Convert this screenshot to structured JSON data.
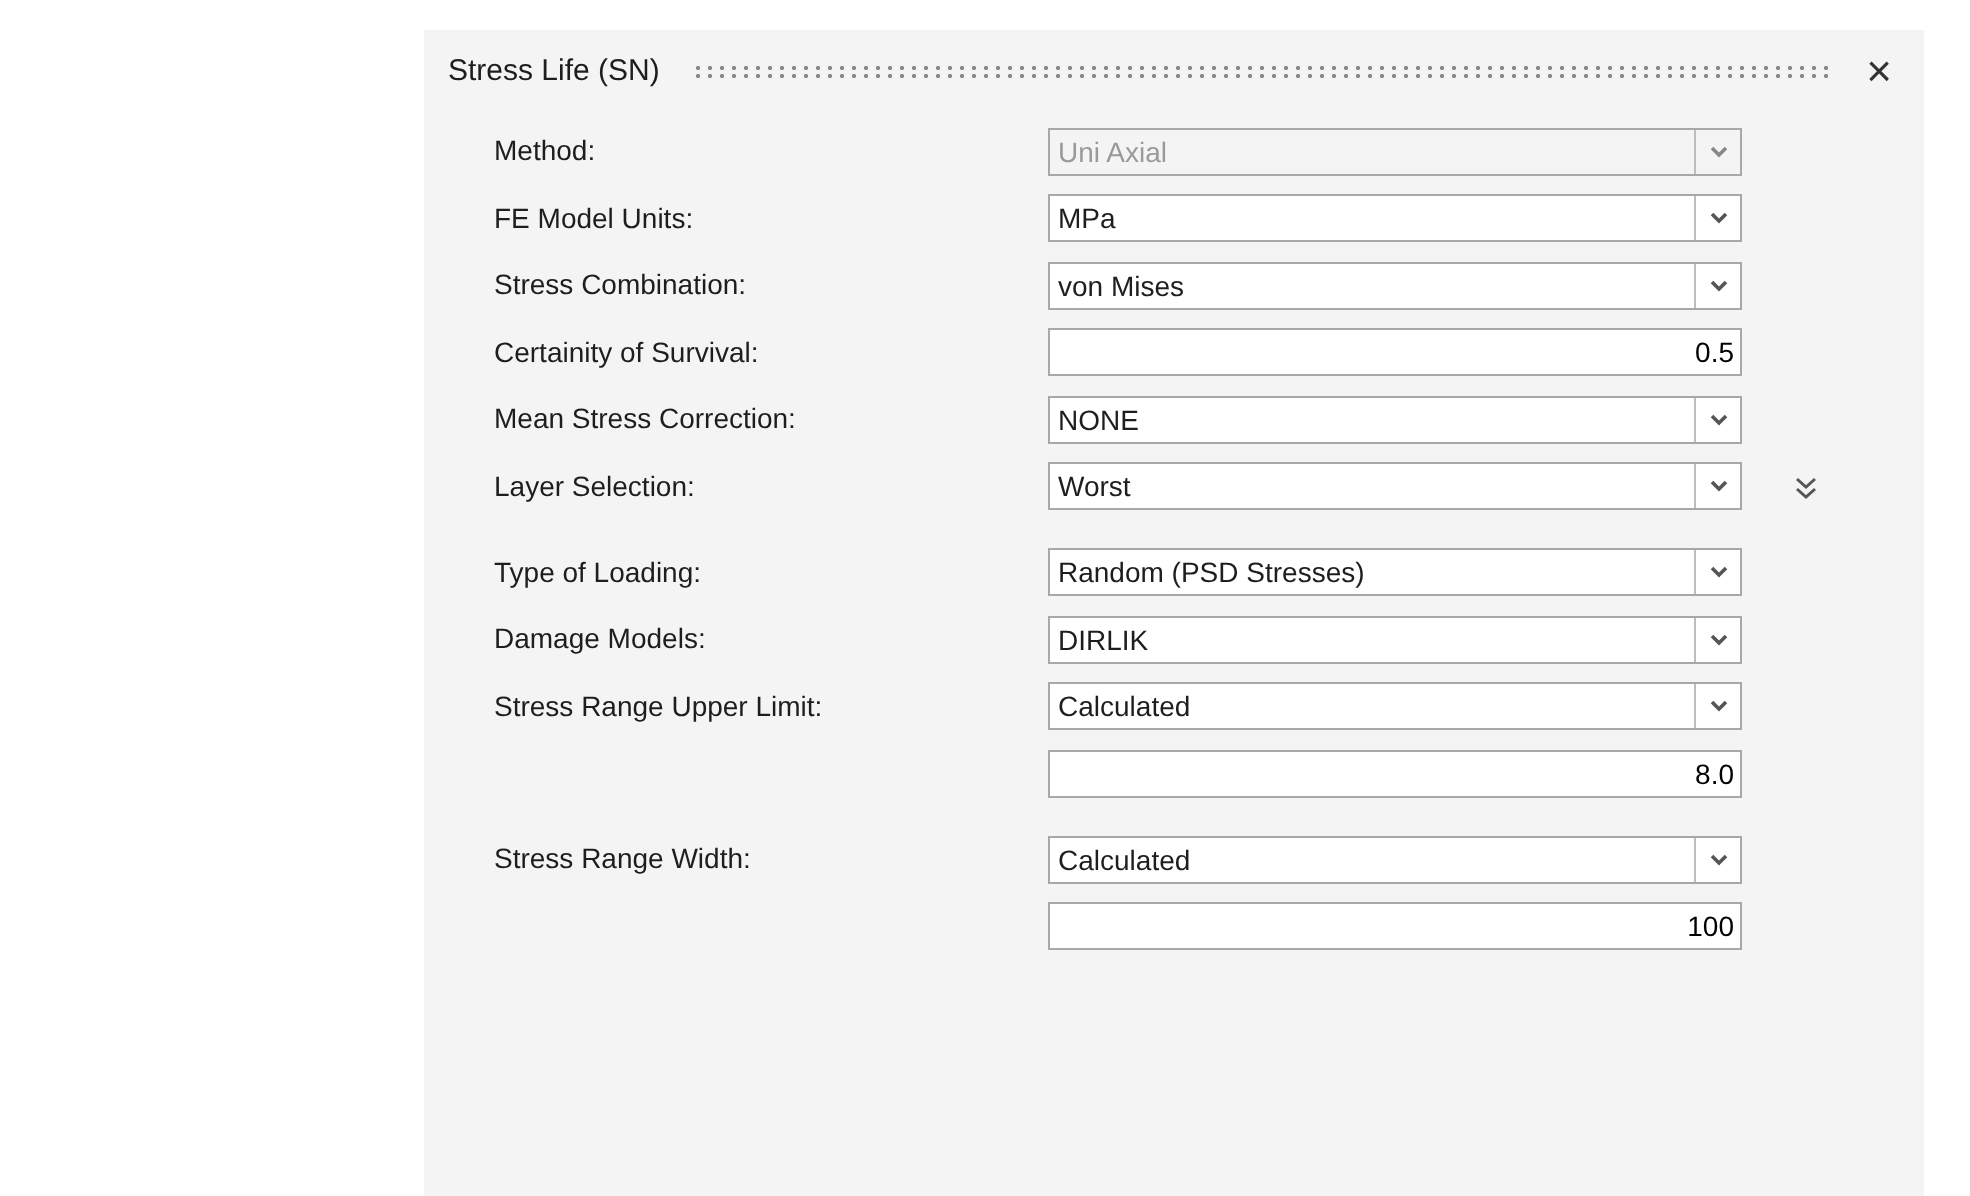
{
  "panel": {
    "title": "Stress Life (SN)",
    "close": "×"
  },
  "rows": [
    {
      "label": "Method:",
      "kind": "select",
      "value": "Uni Axial",
      "disabled": true,
      "expandable": false
    },
    {
      "label": "FE Model Units:",
      "kind": "select",
      "value": "MPa",
      "disabled": false,
      "expandable": false
    },
    {
      "label": "Stress Combination:",
      "kind": "select",
      "value": "von Mises",
      "disabled": false,
      "expandable": false
    },
    {
      "label": "Certainity of Survival:",
      "kind": "number",
      "value": "0.5",
      "disabled": false,
      "expandable": false
    },
    {
      "label": "Mean Stress Correction:",
      "kind": "select",
      "value": "NONE",
      "disabled": false,
      "expandable": false
    },
    {
      "label": "Layer Selection:",
      "kind": "select",
      "value": "Worst",
      "disabled": false,
      "expandable": true
    },
    {
      "label": "Type of Loading:",
      "kind": "select",
      "value": "Random (PSD Stresses)",
      "disabled": false,
      "expandable": false
    },
    {
      "label": "Damage Models:",
      "kind": "select",
      "value": "DIRLIK",
      "disabled": false,
      "expandable": false
    },
    {
      "label": "Stress Range Upper Limit:",
      "kind": "select",
      "value": "Calculated",
      "disabled": false,
      "expandable": false
    },
    {
      "kind": "number",
      "value": "8.0",
      "disabled": false,
      "expandable": false
    },
    {
      "label": "Stress Range Width:",
      "kind": "select",
      "value": "Calculated",
      "disabled": false,
      "expandable": false
    },
    {
      "kind": "number",
      "value": "100",
      "disabled": false,
      "expandable": false
    }
  ]
}
